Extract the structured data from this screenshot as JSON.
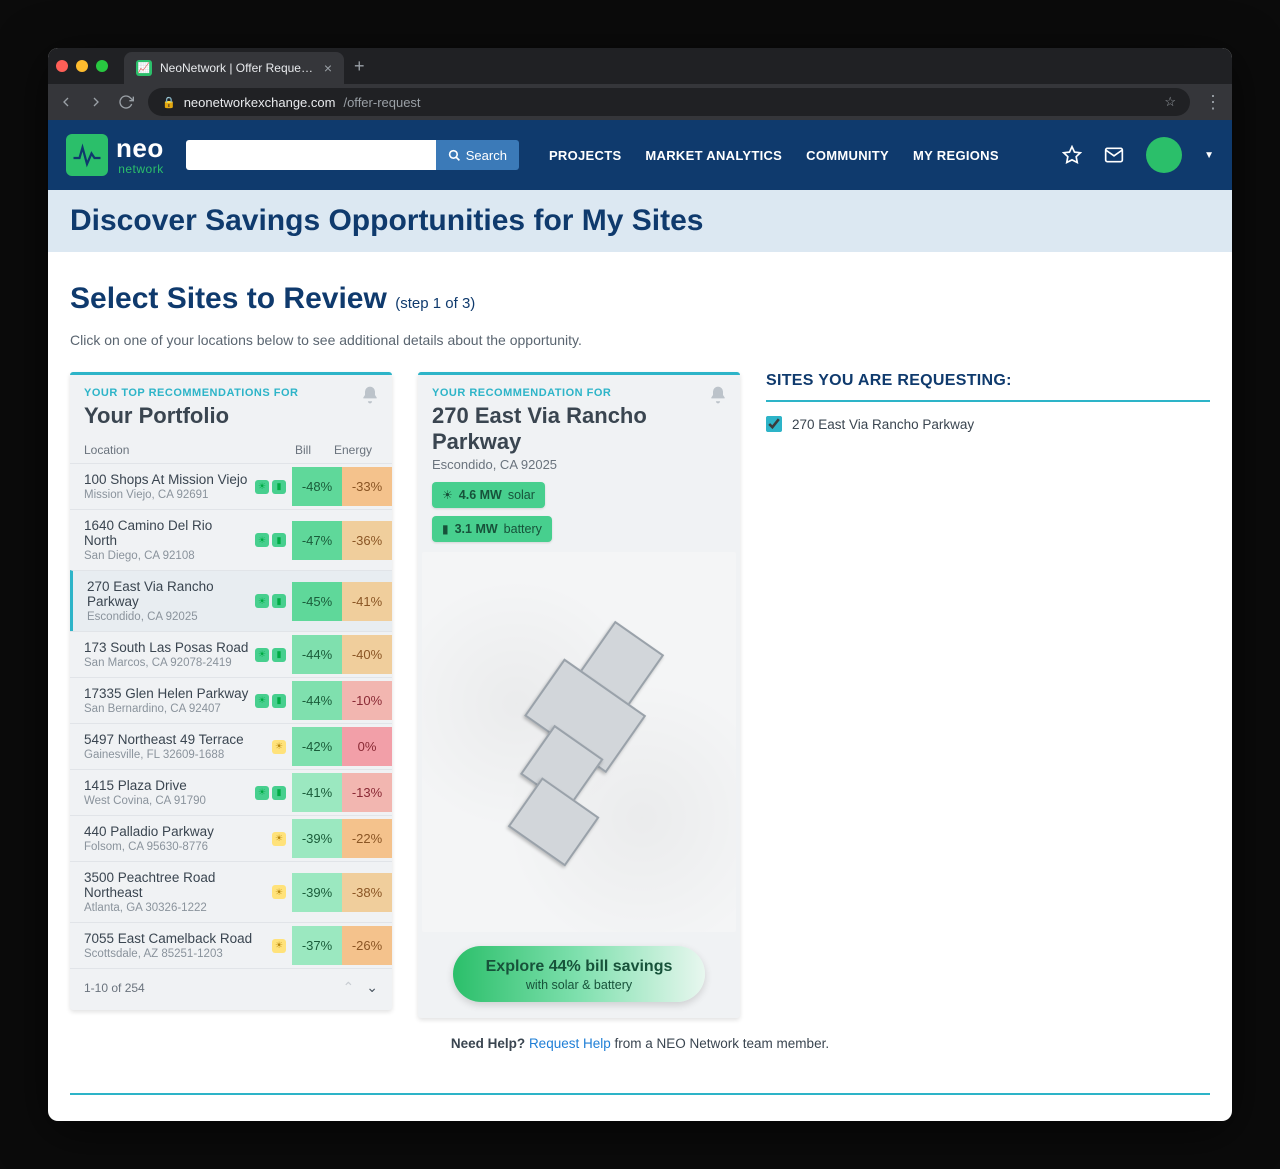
{
  "browser": {
    "tab_title": "NeoNetwork | Offer Request Fo",
    "url_host": "neonetworkexchange.com",
    "url_path": "/offer-request"
  },
  "header": {
    "brand": "neo",
    "brand_sub": "network",
    "search_button": "Search",
    "nav": {
      "projects": "PROJECTS",
      "analytics": "MARKET ANALYTICS",
      "community": "COMMUNITY",
      "regions": "MY REGIONS"
    }
  },
  "subheader": {
    "title": "Discover Savings Opportunities for My Sites"
  },
  "page": {
    "heading": "Select Sites to Review",
    "step": "(step 1 of 3)",
    "instruction": "Click on one of your locations below to see additional details about the opportunity."
  },
  "portfolio": {
    "label": "YOUR TOP RECOMMENDATIONS FOR",
    "title": "Your Portfolio",
    "columns": {
      "location": "Location",
      "bill": "Bill",
      "energy": "Energy"
    },
    "rows": [
      {
        "name": "100 Shops At Mission Viejo",
        "addr": "Mission Viejo, CA 92691",
        "bill": "-48%",
        "energy": "-33%",
        "solar_only": false
      },
      {
        "name": "1640 Camino Del Rio North",
        "addr": "San Diego, CA 92108",
        "bill": "-47%",
        "energy": "-36%",
        "solar_only": false
      },
      {
        "name": "270 East Via Rancho Parkway",
        "addr": "Escondido, CA 92025",
        "bill": "-45%",
        "energy": "-41%",
        "solar_only": false,
        "selected": true
      },
      {
        "name": "173 South Las Posas Road",
        "addr": "San Marcos, CA 92078-2419",
        "bill": "-44%",
        "energy": "-40%",
        "solar_only": false
      },
      {
        "name": "17335 Glen Helen Parkway",
        "addr": "San Bernardino, CA 92407",
        "bill": "-44%",
        "energy": "-10%",
        "solar_only": false
      },
      {
        "name": "5497 Northeast 49 Terrace",
        "addr": "Gainesville, FL 32609-1688",
        "bill": "-42%",
        "energy": "0%",
        "solar_only": true
      },
      {
        "name": "1415 Plaza Drive",
        "addr": "West Covina, CA 91790",
        "bill": "-41%",
        "energy": "-13%",
        "solar_only": false
      },
      {
        "name": "440 Palladio Parkway",
        "addr": "Folsom, CA 95630-8776",
        "bill": "-39%",
        "energy": "-22%",
        "solar_only": true
      },
      {
        "name": "3500 Peachtree Road Northeast",
        "addr": "Atlanta, GA 30326-1222",
        "bill": "-39%",
        "energy": "-38%",
        "solar_only": true
      },
      {
        "name": "7055 East Camelback Road",
        "addr": "Scottsdale, AZ 85251-1203",
        "bill": "-37%",
        "energy": "-26%",
        "solar_only": true
      }
    ],
    "pager": "1-10 of 254"
  },
  "detail": {
    "label": "YOUR RECOMMENDATION FOR",
    "title": "270 East Via Rancho Parkway",
    "subtitle": "Escondido, CA 92025",
    "chip_solar_value": "4.6 MW",
    "chip_solar_type": "solar",
    "chip_batt_value": "3.1 MW",
    "chip_batt_type": "battery",
    "cta_line1": "Explore 44% bill savings",
    "cta_line2": "with solar & battery"
  },
  "requesting": {
    "heading": "SITES YOU ARE REQUESTING:",
    "items": [
      "270 East Via Rancho Parkway"
    ]
  },
  "help": {
    "prefix": "Need Help?",
    "link": "Request Help",
    "suffix": "from a NEO Network team member."
  }
}
